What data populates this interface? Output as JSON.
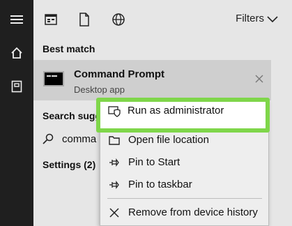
{
  "rail": {
    "icons": [
      "hamburger-icon",
      "home-icon",
      "notebook-icon"
    ]
  },
  "toolbar": {
    "icons": [
      "apps-icon",
      "document-icon",
      "globe-icon"
    ],
    "filters_label": "Filters"
  },
  "best_match": {
    "section_label": "Best match",
    "title": "Command Prompt",
    "subtitle": "Desktop app"
  },
  "search_suggestions": {
    "section_label_partial": "Search sugge",
    "query_partial": "comma"
  },
  "settings": {
    "label": "Settings (2)"
  },
  "context_menu": {
    "run_as_admin": "Run as administrator",
    "open_file_location": "Open file location",
    "pin_to_start": "Pin to Start",
    "pin_to_taskbar": "Pin to taskbar",
    "remove_history": "Remove from device history"
  },
  "colors": {
    "rail": "#1f1f1f",
    "panel": "#e6e6e6",
    "selected_row": "#cfcfcf",
    "highlight": "#7fd64a"
  }
}
